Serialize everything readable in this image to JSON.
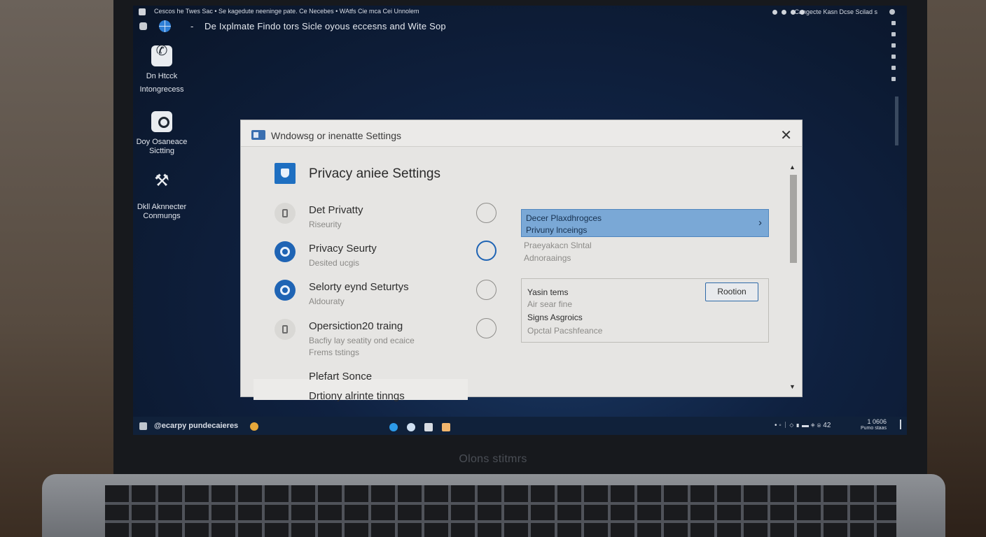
{
  "topbar": {
    "menu_text": "Cescos he Twes Sac  •  Se kagedute neeninge pate.   Ce Necebes  •  WAtfs Cie mca  Cei  Unnolem",
    "status_text": "Cangecte  Kasn  Dcse  Scilad s"
  },
  "addressbar": {
    "dash": "-",
    "text": "De Ixplmate   Findo tors Sicle oyous eccesns  and Wite Sop"
  },
  "desktop_icons": [
    {
      "line1": "Dn Htcck",
      "line2": "Intongrecess"
    },
    {
      "line1": "Doy Osaneace",
      "line2": "Sictting"
    },
    {
      "line1": "Dkll Aknnecter",
      "line2": "Conmungs"
    }
  ],
  "window": {
    "title": "Wndowsg or inenatte Settings",
    "close_glyph": "✕",
    "page_title": "Privacy aniee Settings",
    "items": [
      {
        "label": "Det Privatty",
        "sub": "Riseurity"
      },
      {
        "label": "Privacy Seurty",
        "sub": "Desited ucgis"
      },
      {
        "label": "Selorty eynd Seturtys",
        "sub": "Aldouraty"
      },
      {
        "label": "Opersiction20 traing",
        "sub": "Bacfiy lay seatity ond ecaice",
        "sub2": "Frems tstings"
      },
      {
        "label": "Plefart Sonce",
        "sub": ""
      },
      {
        "label": "Drtiony alrinte tinngs",
        "sub": ""
      }
    ],
    "right_panel": {
      "highlight_line1": "Decer Plaxdhrogces",
      "highlight_line2": "Privuny lnceings",
      "chevron": "›",
      "sub1": "Praeyakacn Slntal",
      "sub2": "Adnoraaings",
      "box_line1": "Yasin tems",
      "box_line2": "Air sear fine",
      "box_line3": "Signs Asgroics",
      "box_line4": "Opctal Pacshfeance",
      "box_button": "Rootion"
    },
    "scroll_up": "▲",
    "scroll_down": "▼"
  },
  "taskbar": {
    "label": "@ecarpy pundecaieres",
    "tray_text": "• ◦ ᛁ ◇ ▮ ▬ ◈ ◉ 42",
    "clock_top": "1 0606",
    "clock_bottom": "Pumo staas"
  },
  "chin_label": "Olons stitmrs",
  "colors": {
    "accent": "#1f64b4",
    "highlight": "#7aa8d6",
    "desktop": "#0f2140",
    "window_bg": "#e6e5e3"
  }
}
